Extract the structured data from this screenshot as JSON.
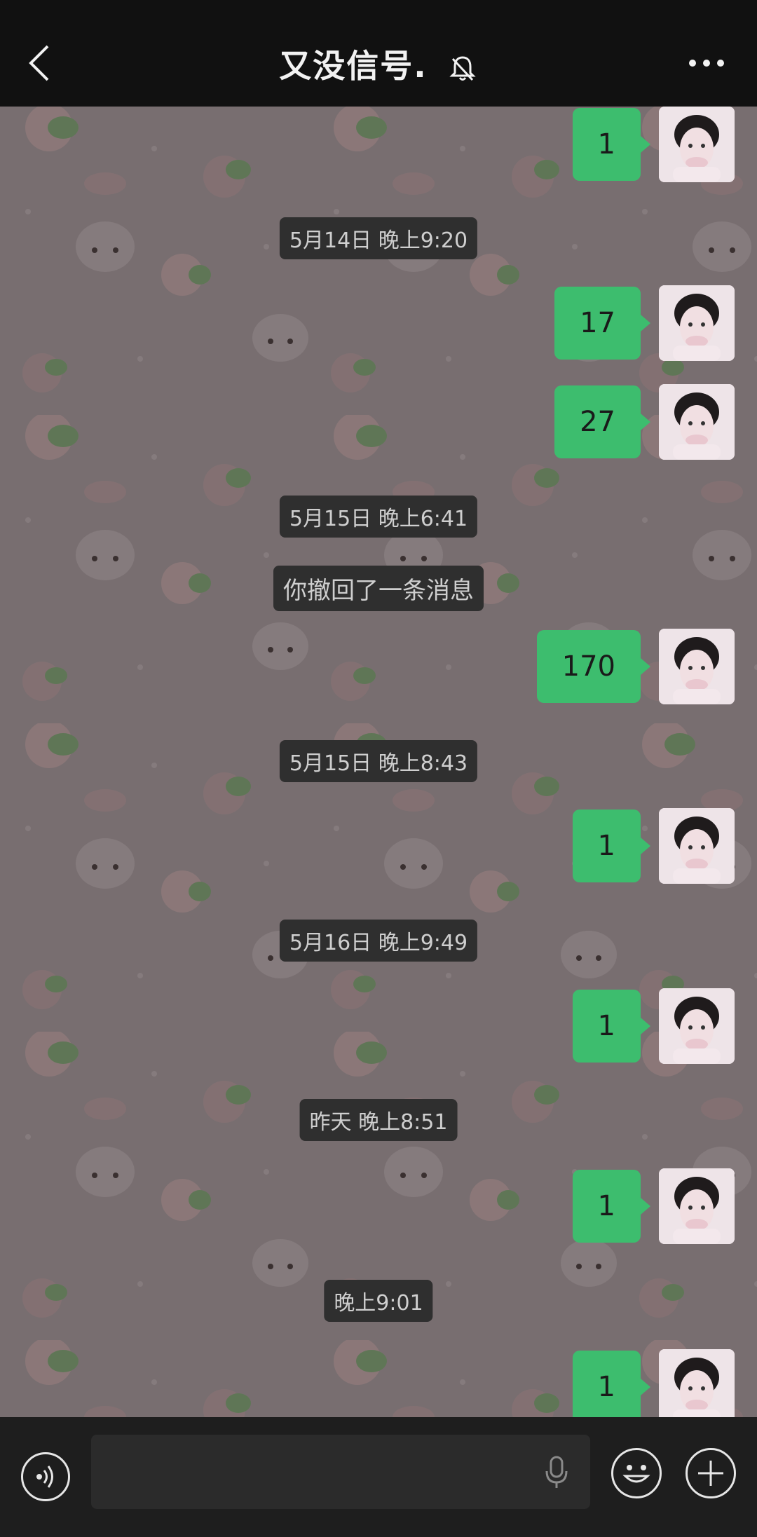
{
  "header": {
    "title": "又没信号.",
    "icons": [
      "back-arrow-icon",
      "mute-bell-icon",
      "more-dots-icon"
    ]
  },
  "messages": [
    {
      "type": "sent",
      "text": "1"
    },
    {
      "type": "time",
      "text": "5月14日 晚上9:20"
    },
    {
      "type": "sent",
      "text": "17"
    },
    {
      "type": "sent",
      "text": "27"
    },
    {
      "type": "time",
      "text": "5月15日 晚上6:41"
    },
    {
      "type": "notice",
      "text": "你撤回了一条消息"
    },
    {
      "type": "sent",
      "text": "170"
    },
    {
      "type": "time",
      "text": "5月15日 晚上8:43"
    },
    {
      "type": "sent",
      "text": "1"
    },
    {
      "type": "time",
      "text": "5月16日 晚上9:49"
    },
    {
      "type": "sent",
      "text": "1"
    },
    {
      "type": "time",
      "text": "昨天 晚上8:51"
    },
    {
      "type": "sent",
      "text": "1"
    },
    {
      "type": "time",
      "text": "晚上9:01"
    },
    {
      "type": "sent",
      "text": "1"
    }
  ],
  "bottom": {
    "input_value": "",
    "icons": [
      "voice-toggle-icon",
      "microphone-icon",
      "emoji-icon",
      "plus-icon"
    ]
  },
  "colors": {
    "bubble": "#3dbd6e",
    "chat_bg": "#7a7071",
    "time_badge": "#2f2f2f"
  }
}
